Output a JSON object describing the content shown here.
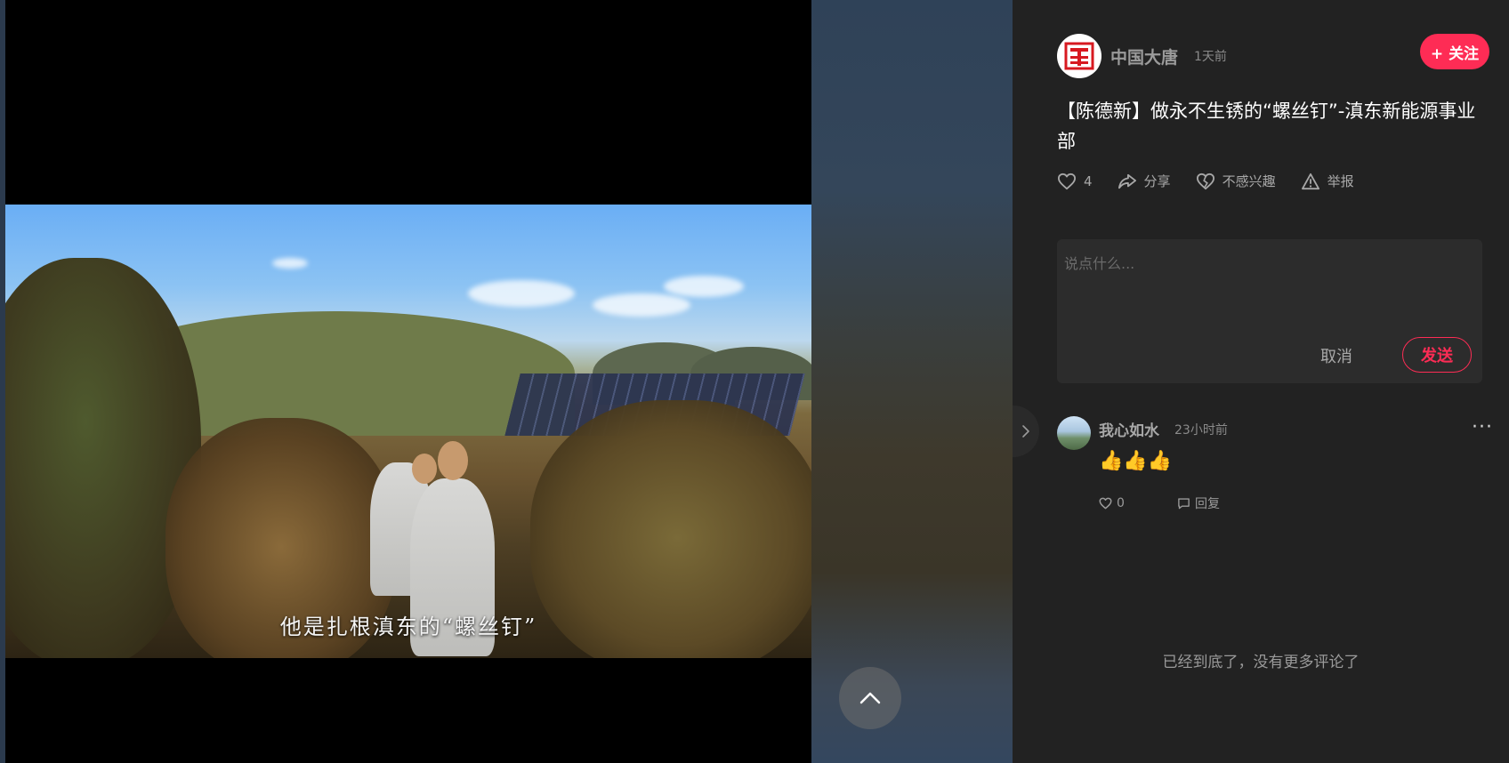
{
  "video": {
    "subtitle": "他是扎根滇东的“螺丝钉”"
  },
  "author": {
    "name": "中国大唐",
    "time": "1天前",
    "follow_label": "+ 关注"
  },
  "post": {
    "title": "【陈德新】做永不生锈的“螺丝钉”-滇东新能源事业部"
  },
  "actions": {
    "like_count": "4",
    "share_label": "分享",
    "dislike_label": "不感兴趣",
    "report_label": "举报"
  },
  "comment_box": {
    "placeholder": "说点什么...",
    "cancel_label": "取消",
    "send_label": "发送"
  },
  "comments": [
    {
      "name": "我心如水",
      "time": "23小时前",
      "text": "👍👍👍",
      "like_count": "0",
      "reply_label": "回复"
    }
  ],
  "footer": {
    "end_text": "已经到底了，没有更多评论了"
  },
  "colors": {
    "accent": "#fe2c55",
    "panel_bg": "#222222"
  }
}
